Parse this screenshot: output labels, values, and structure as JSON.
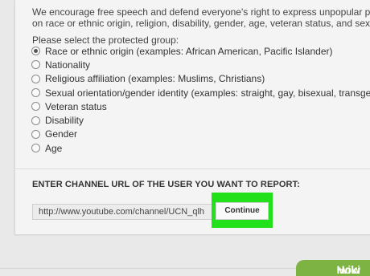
{
  "intro": {
    "line1": "We encourage free speech and defend everyone's right to express unpopular points of",
    "line2": "on race or ethnic origin, religion, disability, gender, age, veteran status, and sexual orien"
  },
  "prompt": "Please select the protected group:",
  "options": [
    {
      "label": "Race or ethnic origin (examples: African American, Pacific Islander)",
      "checked": true
    },
    {
      "label": "Nationality",
      "checked": false
    },
    {
      "label": "Religious affiliation (examples: Muslims, Christians)",
      "checked": false
    },
    {
      "label": "Sexual orientation/gender identity (examples: straight, gay, bisexual, transgender)",
      "checked": false
    },
    {
      "label": "Veteran status",
      "checked": false
    },
    {
      "label": "Disability",
      "checked": false
    },
    {
      "label": "Gender",
      "checked": false
    },
    {
      "label": "Age",
      "checked": false
    }
  ],
  "url_section": {
    "heading": "ENTER CHANNEL URL OF THE USER YOU WANT TO REPORT:",
    "value": "http://www.youtube.com/channel/UCN_qlh",
    "button_label": "Continue"
  },
  "colors": {
    "highlight": "#22e01a",
    "watermark": "#7cb342"
  },
  "watermark": {
    "wiki": "wiki",
    "how": "How"
  }
}
